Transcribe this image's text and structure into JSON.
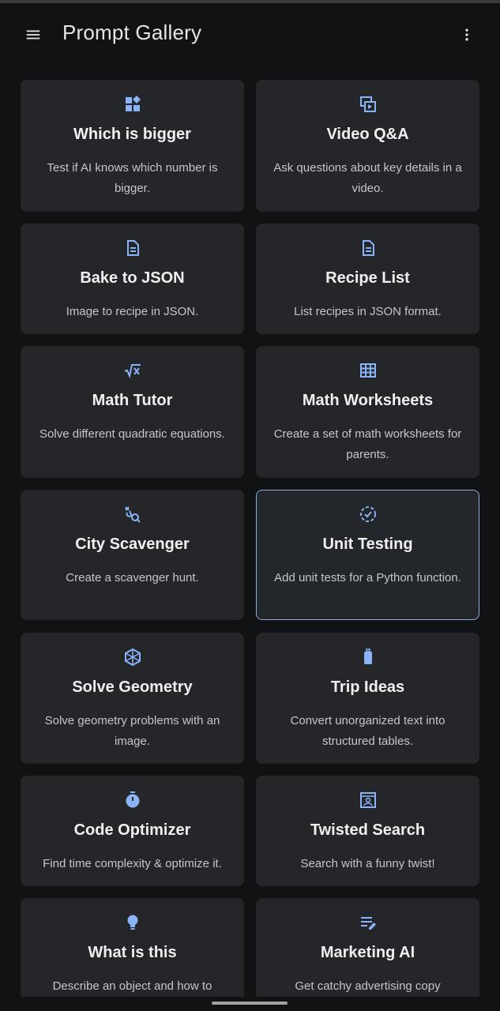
{
  "app": {
    "title": "Prompt Gallery"
  },
  "colors": {
    "background": "#111214",
    "card": "#25262a",
    "accent": "#8ab4f8",
    "selected_border": "#8bacdd"
  },
  "cards": [
    {
      "icon": "widgets-icon",
      "title": "Which is bigger",
      "desc": "Test if AI knows which number is bigger."
    },
    {
      "icon": "video-library-icon",
      "title": "Video Q&A",
      "desc": "Ask questions about key details in a video."
    },
    {
      "icon": "document-icon",
      "title": "Bake to JSON",
      "desc": "Image to recipe in JSON."
    },
    {
      "icon": "document-icon",
      "title": "Recipe List",
      "desc": "List recipes in JSON format."
    },
    {
      "icon": "square-root-icon",
      "title": "Math Tutor",
      "desc": "Solve different quadratic equations."
    },
    {
      "icon": "table-icon",
      "title": "Math Worksheets",
      "desc": "Create a set of math worksheets for parents."
    },
    {
      "icon": "route-search-icon",
      "title": "City Scavenger",
      "desc": "Create a scavenger hunt."
    },
    {
      "icon": "dashed-check-circle-icon",
      "title": "Unit Testing",
      "desc": "Add unit tests for a Python function."
    },
    {
      "icon": "polyhedron-icon",
      "title": "Solve Geometry",
      "desc": "Solve geometry problems with an image."
    },
    {
      "icon": "luggage-icon",
      "title": "Trip Ideas",
      "desc": "Convert unorganized text into structured tables."
    },
    {
      "icon": "timer-icon",
      "title": "Code Optimizer",
      "desc": "Find time complexity & optimize it."
    },
    {
      "icon": "portrait-frame-icon",
      "title": "Twisted Search",
      "desc": "Search with a funny twist!"
    },
    {
      "icon": "lightbulb-icon",
      "title": "What is this",
      "desc": "Describe an object and how to"
    },
    {
      "icon": "edit-notes-icon",
      "title": "Marketing AI",
      "desc": "Get catchy advertising copy"
    }
  ]
}
